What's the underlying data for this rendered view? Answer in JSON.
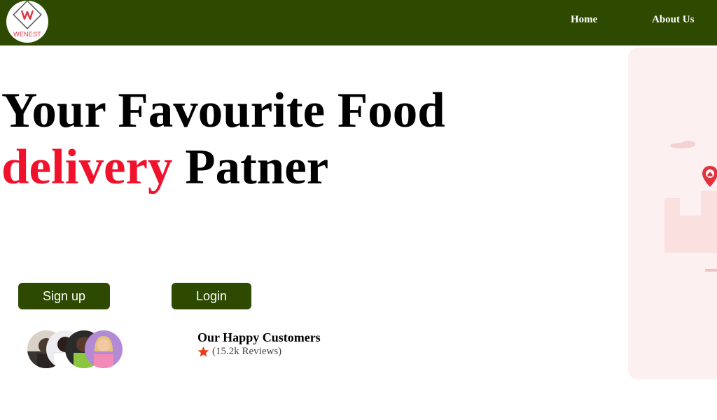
{
  "brand": {
    "logo_text": "WENEST"
  },
  "nav": {
    "home": "Home",
    "about": "About Us"
  },
  "hero": {
    "title_line1": "Your Favourite Food",
    "title_accent": "delivery",
    "title_rest": "Patner",
    "accent_color": "#f0122d"
  },
  "actions": {
    "signup": "Sign up",
    "login": "Login"
  },
  "customers": {
    "title": "Our Happy Customers",
    "reviews": "(15.2k Reviews)"
  },
  "colors": {
    "primary": "#2d4a00",
    "accent": "#f0122d",
    "illustration_bg": "#fdf0f0"
  },
  "icons": {
    "rating": "star-icon",
    "map": "map-pin-icon"
  }
}
